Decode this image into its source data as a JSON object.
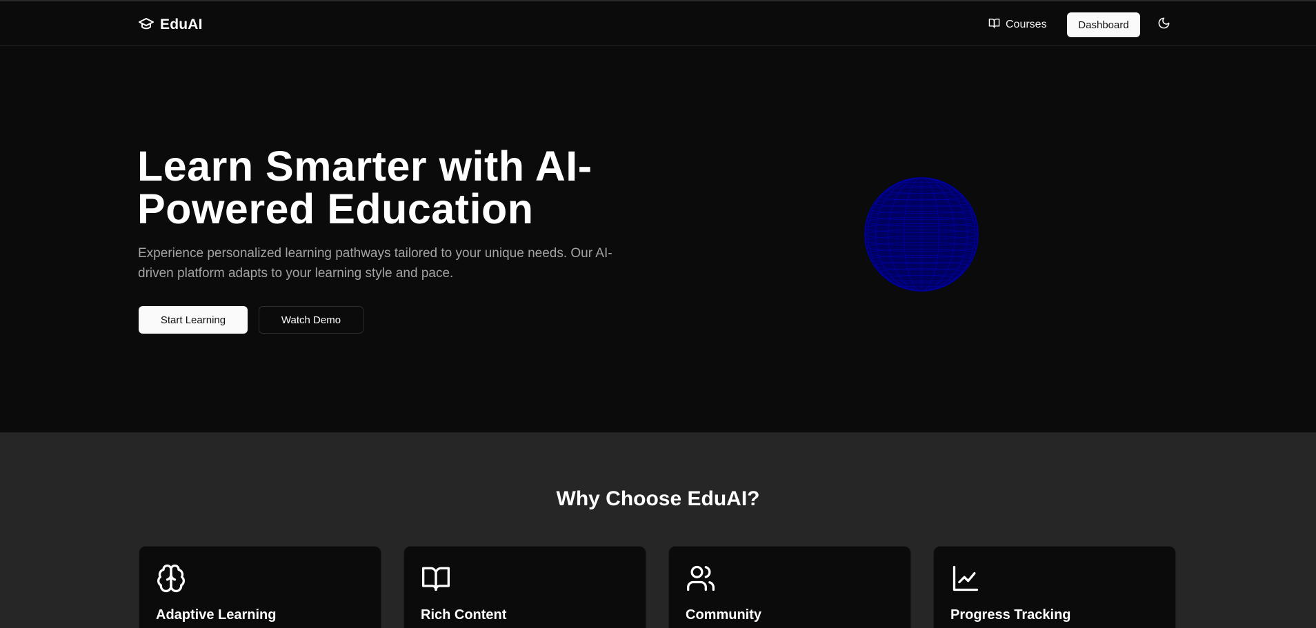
{
  "brand": {
    "name": "EduAI",
    "icon": "graduation-cap-icon"
  },
  "nav": {
    "courses_label": "Courses",
    "courses_icon": "book-open-icon",
    "dashboard_label": "Dashboard",
    "theme_icon": "moon-icon"
  },
  "hero": {
    "title_line1": "Learn Smarter with AI-",
    "title_line2": "Powered Education",
    "subtitle_line1": "Experience personalized learning pathways tailored to your unique needs. Our AI-",
    "subtitle_line2": "driven platform adapts to your learning style and pace.",
    "primary_button": "Start Learning",
    "secondary_button": "Watch Demo",
    "globe_color": "#00008b"
  },
  "features": {
    "heading": "Why Choose EduAI?",
    "cards": [
      {
        "title": "Adaptive Learning",
        "icon": "brain-icon"
      },
      {
        "title": "Rich Content",
        "icon": "book-open-icon"
      },
      {
        "title": "Community",
        "icon": "users-icon"
      },
      {
        "title": "Progress Tracking",
        "icon": "line-chart-icon"
      }
    ]
  },
  "colors": {
    "background": "#0b0b0b",
    "section_background": "#262626",
    "text_primary": "#ffffff",
    "text_muted": "#a3a3a3",
    "button_light": "#fafafa"
  }
}
